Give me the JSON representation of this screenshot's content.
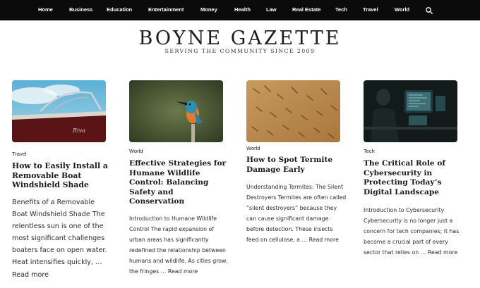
{
  "nav": {
    "items": [
      "Home",
      "Business",
      "Education",
      "Entertainment",
      "Money",
      "Health",
      "Law",
      "Real Estate",
      "Tech",
      "Travel",
      "World"
    ],
    "search_icon": "search-icon"
  },
  "masthead": {
    "title": "BOYNE GAZETTE",
    "tagline": "SERVING THE COMMUNITY SINCE 2009"
  },
  "articles": [
    {
      "category": "Travel",
      "title": "How to Easily Install a Removable Boat Windshield Shade",
      "excerpt": "Benefits of a Removable Boat Windshield Shade The relentless sun is one of the most significant challenges boaters face on open water. Heat intensifies quickly, …",
      "read_more": "Read more",
      "image": "boat-photo"
    },
    {
      "category": "World",
      "title": "Effective Strategies for Humane Wildlife Control: Balancing Safety and Conservation",
      "excerpt": "Introduction to Humane Wildlife Control The rapid expansion of urban areas has significantly redefined the relationship between humans and wildlife. As cities grow, the fringes …",
      "read_more": "Read more",
      "image": "kingfisher-photo"
    },
    {
      "category": "World",
      "title": "How to Spot Termite Damage Early",
      "excerpt": "Understanding Termites: The Silent Destroyers Termites are often called “silent destroyers” because they can cause significant damage before detection. These insects feed on cellulose, a …",
      "read_more": "Read more",
      "image": "termite-wood-photo"
    },
    {
      "category": "Tech",
      "title": "The Critical Role of Cybersecurity in Protecting Today’s Digital Landscape",
      "excerpt": "Introduction to Cybersecurity Cybersecurity is no longer just a concern for tech companies; it has become a crucial part of every sector that relies on …",
      "read_more": "Read more",
      "image": "hacker-computer-photo"
    }
  ],
  "colors": {
    "nav_bg": "#0b0b0b",
    "nav_text": "#ffffff",
    "text": "#1a1a1a"
  }
}
